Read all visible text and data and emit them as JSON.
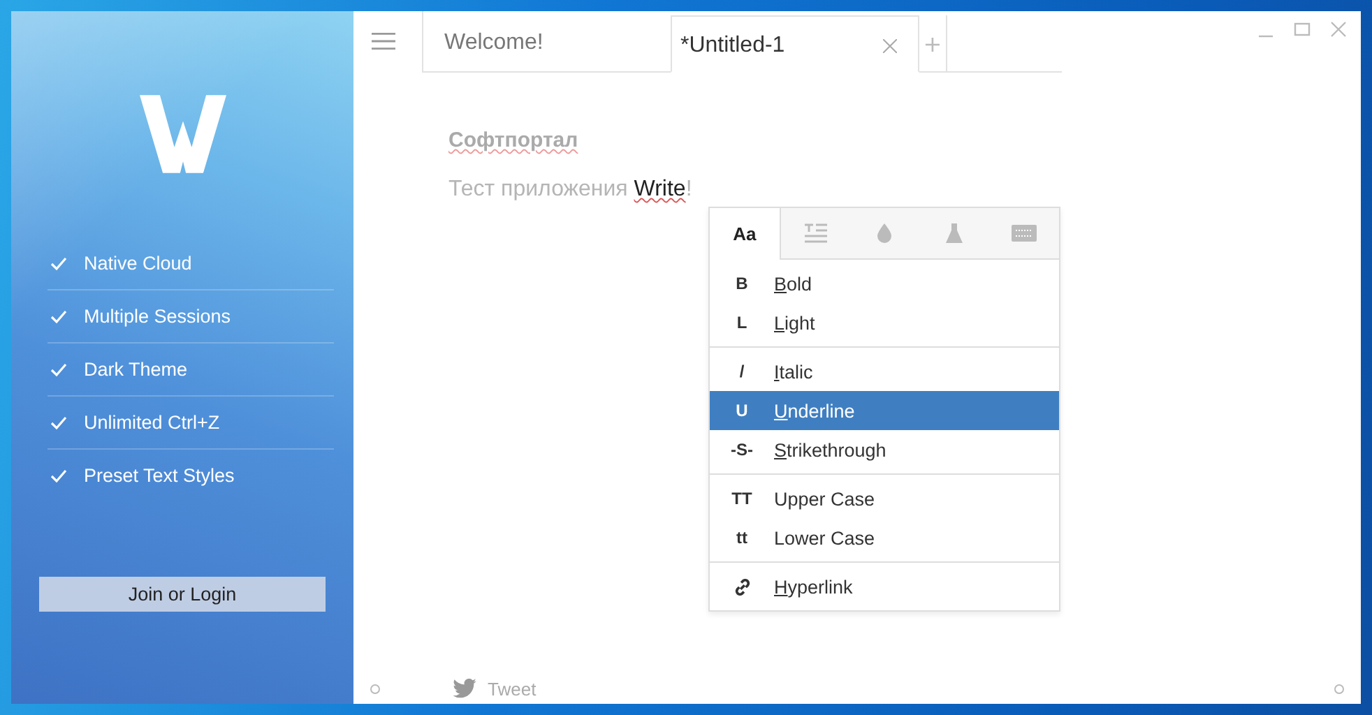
{
  "sidebar": {
    "features": [
      {
        "label": "Native Cloud",
        "checked": true
      },
      {
        "label": "Multiple Sessions",
        "checked": true
      },
      {
        "label": "Dark Theme",
        "checked": true
      },
      {
        "label": "Unlimited Ctrl+Z",
        "checked": true
      },
      {
        "label": "Preset Text Styles",
        "checked": true
      }
    ],
    "login_button": "Join or Login"
  },
  "tabs": [
    {
      "label": "Welcome!",
      "selected": false,
      "closable": false
    },
    {
      "label": "*Untitled-1",
      "selected": true,
      "closable": true
    }
  ],
  "new_tab": "+",
  "document": {
    "heading": "Софтпортал",
    "paragraph": [
      {
        "text": "Тест приложения ",
        "emphasis": false
      },
      {
        "text": "Write",
        "emphasis": true
      },
      {
        "text": "!",
        "emphasis": false
      }
    ]
  },
  "format_popup": {
    "tabs": [
      {
        "label": "Aa",
        "selected": true
      },
      {
        "selected": false
      },
      {
        "selected": false
      },
      {
        "selected": false
      },
      {
        "selected": false
      }
    ],
    "sections": [
      {
        "items": [
          {
            "kind": "glyph",
            "glyph": "B",
            "label": "Bold",
            "mnemonic": true,
            "selected": false
          },
          {
            "kind": "glyph",
            "glyph": "L",
            "label": "Light",
            "mnemonic": true,
            "selected": false
          }
        ]
      },
      {
        "items": [
          {
            "kind": "glyph",
            "glyph": "/",
            "label": "Italic",
            "mnemonic": true,
            "selected": false
          },
          {
            "kind": "glyph",
            "glyph": "U",
            "label": "Underline",
            "mnemonic": true,
            "selected": true
          },
          {
            "kind": "glyph",
            "glyph": "-S-",
            "label": "Strikethrough",
            "mnemonic": true,
            "selected": false
          }
        ]
      },
      {
        "items": [
          {
            "kind": "glyph",
            "glyph": "TT",
            "label": "Upper Case",
            "mnemonic": false,
            "selected": false
          },
          {
            "kind": "glyph",
            "glyph": "tt",
            "label": "Lower Case",
            "mnemonic": false,
            "selected": false
          }
        ]
      },
      {
        "items": [
          {
            "kind": "link",
            "label": "Hyperlink",
            "mnemonic": true,
            "selected": false
          }
        ]
      }
    ]
  },
  "footer": {
    "tweet": "Tweet"
  }
}
